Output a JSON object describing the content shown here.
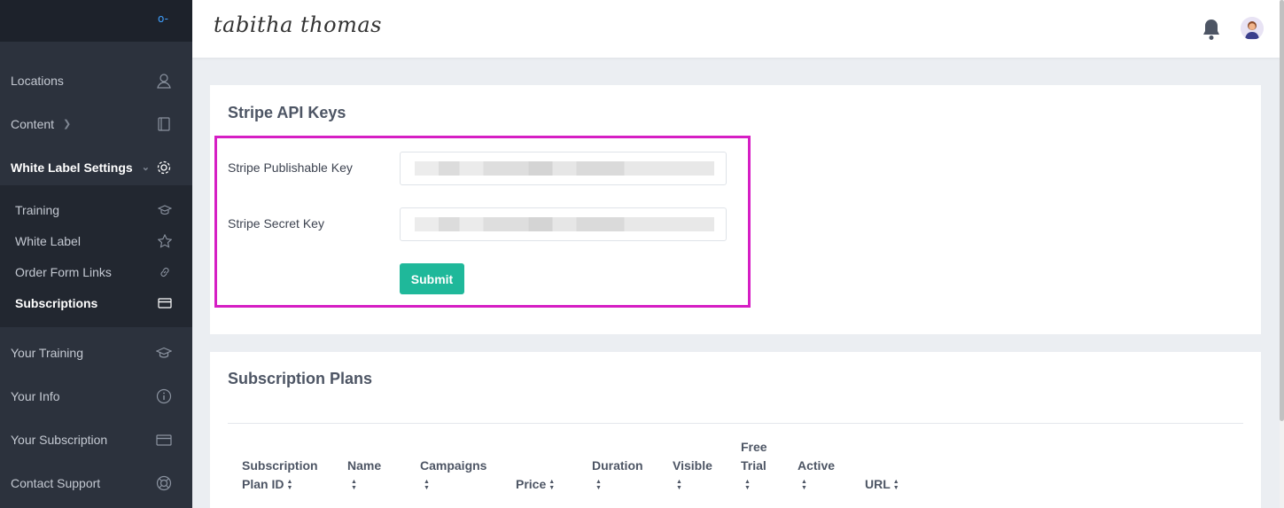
{
  "sidebar": {
    "top_icon": "key-icon",
    "items": [
      {
        "label": "Locations",
        "icon": "user-pin-icon"
      },
      {
        "label": "Content",
        "icon": "book-icon"
      },
      {
        "label": "White Label Settings",
        "icon": "gear-icon"
      },
      {
        "label": "Your Training",
        "icon": "graduation-cap-icon"
      },
      {
        "label": "Your Info",
        "icon": "info-icon"
      },
      {
        "label": "Your Subscription",
        "icon": "credit-card-icon"
      },
      {
        "label": "Contact Support",
        "icon": "lifebuoy-icon"
      }
    ],
    "submenu": [
      {
        "label": "Training",
        "icon": "graduation-cap-icon"
      },
      {
        "label": "White Label",
        "icon": "star-icon"
      },
      {
        "label": "Order Form Links",
        "icon": "link-icon"
      },
      {
        "label": "Subscriptions",
        "icon": "credit-card-icon"
      }
    ]
  },
  "header": {
    "logo_text": "tabitha thomas",
    "icons": [
      "bell-icon",
      "avatar"
    ]
  },
  "stripe": {
    "title": "Stripe API Keys",
    "publishable_label": "Stripe Publishable Key",
    "secret_label": "Stripe Secret Key",
    "submit_label": "Submit"
  },
  "plans": {
    "title": "Subscription Plans",
    "columns": [
      {
        "line1": "Subscription",
        "line2": "Plan ID"
      },
      {
        "line1": "Name",
        "line2": ""
      },
      {
        "line1": "Campaigns",
        "line2": ""
      },
      {
        "line1": "",
        "line2": "Price"
      },
      {
        "line1": "Duration",
        "line2": ""
      },
      {
        "line1": "Visible",
        "line2": ""
      },
      {
        "line1": "Free",
        "line2": "Trial"
      },
      {
        "line1": "Active",
        "line2": ""
      },
      {
        "line1": "",
        "line2": "URL"
      }
    ]
  },
  "colors": {
    "sidebar_bg": "#2c323d",
    "accent_submit": "#1fb89a",
    "highlight_border": "#d61ec4"
  }
}
